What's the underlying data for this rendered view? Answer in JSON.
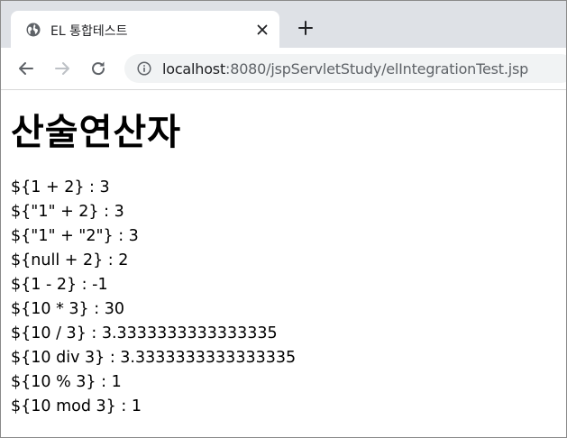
{
  "tab": {
    "title": "EL 통합테스트",
    "favicon": "globe-icon"
  },
  "toolbar": {
    "url_host": "localhost",
    "url_rest": ":8080/jspServletStudy/elIntegrationTest.jsp"
  },
  "page": {
    "heading": "산술연산자",
    "lines": [
      "${1 + 2} : 3",
      "${\"1\" + 2} : 3",
      "${\"1\" + \"2\"} : 3",
      "${null + 2} : 2",
      "${1 - 2} : -1",
      "${10 * 3} : 30",
      "${10 / 3} : 3.3333333333333335",
      "${10 div 3} : 3.3333333333333335",
      "${10 % 3} : 1",
      "${10 mod 3} : 1"
    ]
  },
  "colors": {
    "tabstrip": "#dee1e6",
    "omnibox": "#f1f3f4",
    "icon": "#5f6368",
    "disabled_icon": "#bdc1c6"
  }
}
